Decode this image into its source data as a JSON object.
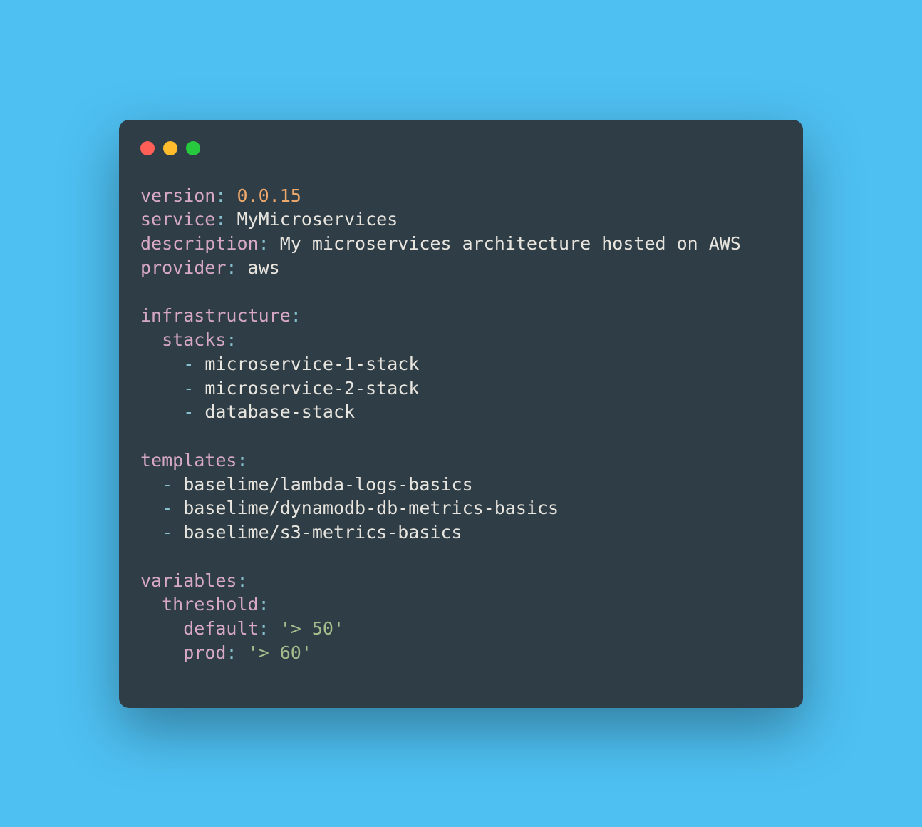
{
  "yaml": {
    "version_key": "version",
    "version_value": "0.0.15",
    "service_key": "service",
    "service_value": "MyMicroservices",
    "description_key": "description",
    "description_value": "My microservices architecture hosted on AWS",
    "provider_key": "provider",
    "provider_value": "aws",
    "infrastructure_key": "infrastructure",
    "stacks_key": "stacks",
    "stacks": [
      "microservice-1-stack",
      "microservice-2-stack",
      "database-stack"
    ],
    "templates_key": "templates",
    "templates": [
      "baselime/lambda-logs-basics",
      "baselime/dynamodb-db-metrics-basics",
      "baselime/s3-metrics-basics"
    ],
    "variables_key": "variables",
    "threshold_key": "threshold",
    "default_key": "default",
    "default_value": "'> 50'",
    "prod_key": "prod",
    "prod_value": "'> 60'"
  },
  "colon": ":",
  "dash": "-"
}
